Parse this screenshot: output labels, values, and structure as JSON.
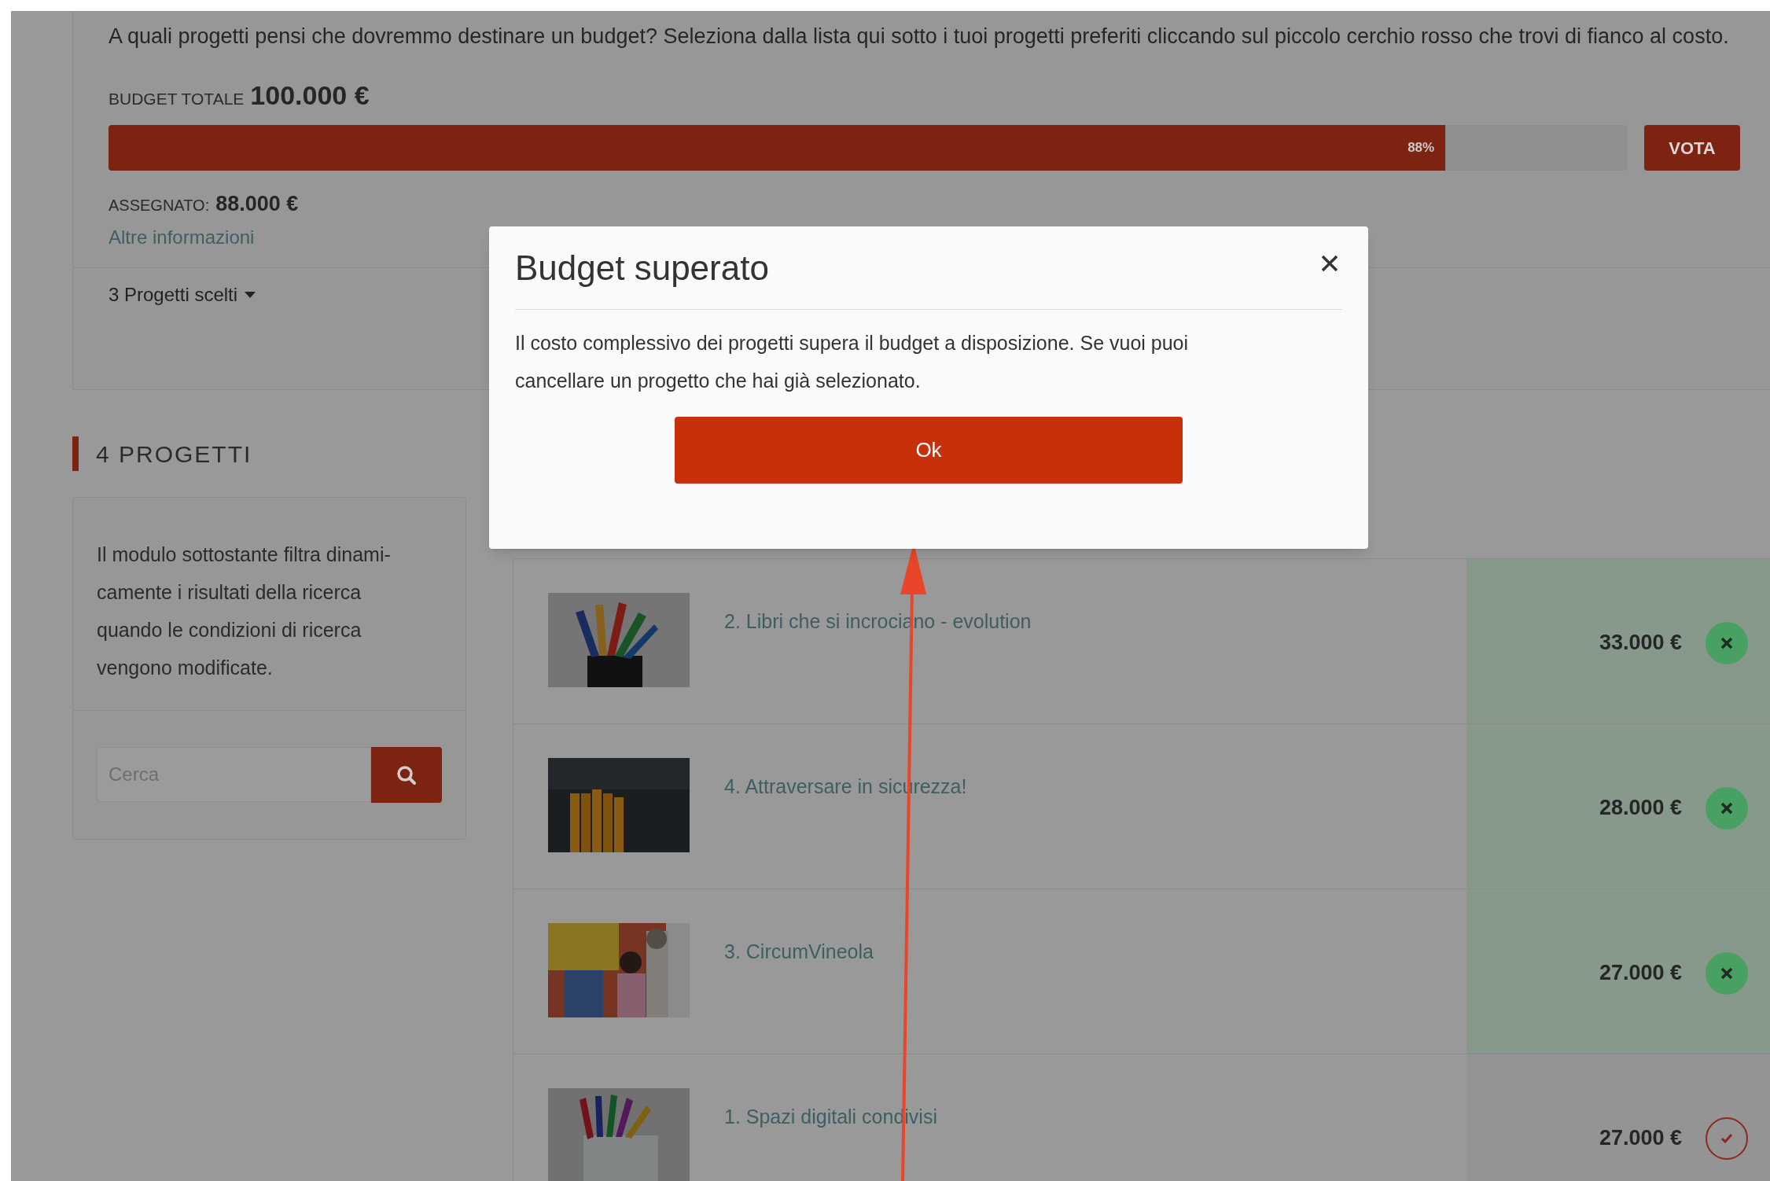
{
  "intro": "A quali progetti pensi che dovremmo destinare un budget? Seleziona dalla lista qui sotto i tuoi progetti preferiti cliccando sul piccolo cerchio rosso che trovi di fianco al costo.",
  "budget": {
    "label": "BUDGET TOTALE",
    "amount": "100.000 €",
    "level": 0.88,
    "percent": "88%"
  },
  "vote_button": "VOTA",
  "assigned": {
    "label": "ASSEGNATO:",
    "amount": "88.000 €"
  },
  "more_info": "Altre informazioni",
  "chosen_dropdown": "3 Progetti scelti",
  "section_title": "4 PROGETTI",
  "filter": {
    "description": "Il modulo sottostante filtra dinami-camente i risultati della ricerca quando le condizioni di ricerca vengono modificate.",
    "placeholder": "Cerca"
  },
  "projects": [
    {
      "title": "2. Libri che si incrociano - evolution",
      "price": "33.000 €",
      "selected": true
    },
    {
      "title": "4. Attraversare in sicurezza!",
      "price": "28.000 €",
      "selected": true
    },
    {
      "title": "3. CircumVineola",
      "price": "27.000 €",
      "selected": true
    },
    {
      "title": "1. Spazi digitali condivisi",
      "price": "27.000 €",
      "selected": false
    }
  ],
  "modal": {
    "title": "Budget superato",
    "body": "Il costo complessivo dei progetti supera il budget a disposizione. Se vuoi puoi cancellare un progetto che hai già selezionato.",
    "ok_button": "Ok"
  }
}
